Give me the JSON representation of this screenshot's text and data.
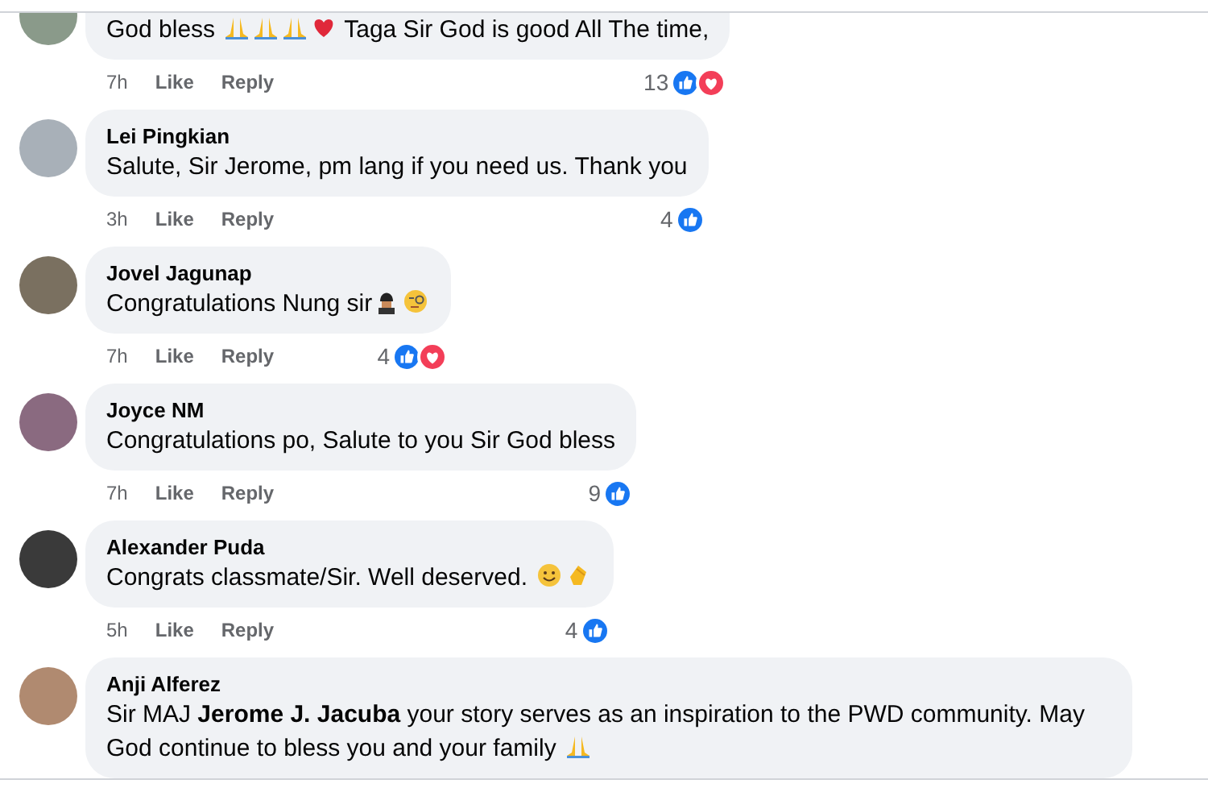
{
  "comments": [
    {
      "body": [
        {
          "kind": "text",
          "text": "God bless "
        },
        {
          "kind": "pray"
        },
        {
          "kind": "pray"
        },
        {
          "kind": "pray"
        },
        {
          "kind": "heart"
        },
        {
          "kind": "text",
          "text": " Taga Sir God is good All The time,"
        }
      ],
      "time": "7h",
      "like": "Like",
      "reply": "Reply",
      "count": "13",
      "reactions": [
        {
          "kind": "like"
        },
        {
          "kind": "love"
        }
      ]
    },
    {
      "author": "Lei Pingkian",
      "body": [
        {
          "kind": "text",
          "text": "Salute, Sir Jerome, pm lang if you need us. Thank you"
        }
      ],
      "time": "3h",
      "like": "Like",
      "reply": "Reply",
      "count": "4",
      "reactions": [
        {
          "kind": "like"
        }
      ]
    },
    {
      "author": "Jovel Jagunap",
      "body": [
        {
          "kind": "text",
          "text": "Congratulations Nung sir"
        },
        {
          "kind": "guard"
        },
        {
          "kind": "monocle"
        }
      ],
      "time": "7h",
      "like": "Like",
      "reply": "Reply",
      "count": "4",
      "reactions": [
        {
          "kind": "like"
        },
        {
          "kind": "love"
        }
      ]
    },
    {
      "author": "Joyce NM",
      "body": [
        {
          "kind": "text",
          "text": "Congratulations po, Salute to you Sir God bless"
        }
      ],
      "time": "7h",
      "like": "Like",
      "reply": "Reply",
      "count": "9",
      "reactions": [
        {
          "kind": "like"
        }
      ]
    },
    {
      "author": "Alexander Puda",
      "body": [
        {
          "kind": "text",
          "text": "Congrats classmate/Sir. Well deserved. "
        },
        {
          "kind": "smile"
        },
        {
          "kind": "clap"
        }
      ],
      "time": "5h",
      "like": "Like",
      "reply": "Reply",
      "count": "4",
      "reactions": [
        {
          "kind": "like"
        }
      ]
    },
    {
      "author": "Anji Alferez",
      "body": [
        {
          "kind": "text",
          "text": "Sir MAJ **Jerome J. Jacuba** your story serves as an inspiration to the PWD community. May God continue to bless you and your family "
        },
        {
          "kind": "pray"
        }
      ]
    }
  ]
}
